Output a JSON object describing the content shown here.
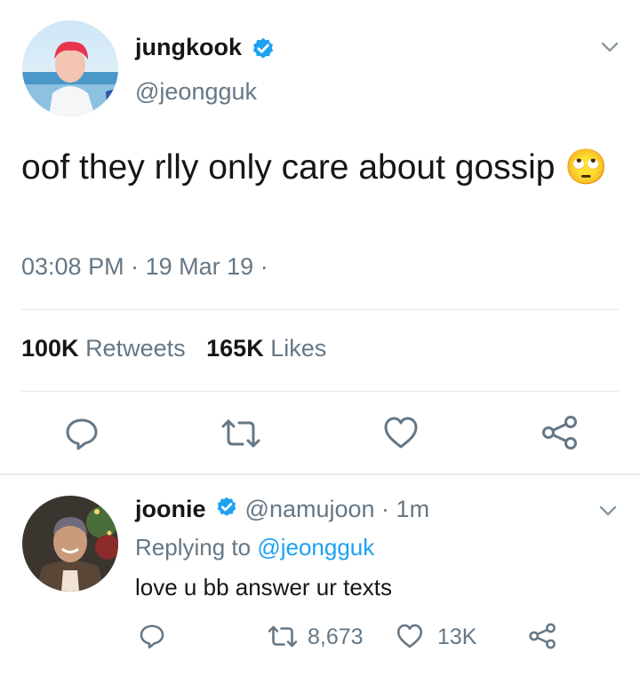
{
  "tweet": {
    "display_name": "jungkook",
    "handle": "@jeongguk",
    "text": "oof they rlly only care about gossip",
    "emoji": "🙄",
    "time": "03:08 PM",
    "date": "19 Mar 19",
    "retweets_count": "100K",
    "retweets_label": "Retweets",
    "likes_count": "165K",
    "likes_label": "Likes"
  },
  "reply": {
    "display_name": "joonie",
    "handle": "@namujoon",
    "age": "1m",
    "replying_prefix": "Replying to",
    "replying_handle": "@jeongguk",
    "text": "love u bb answer ur texts",
    "retweets": "8,673",
    "likes": "13K"
  },
  "colors": {
    "accent": "#1da1f2",
    "secondary_text": "#657786",
    "divider": "#e1e8ed"
  }
}
